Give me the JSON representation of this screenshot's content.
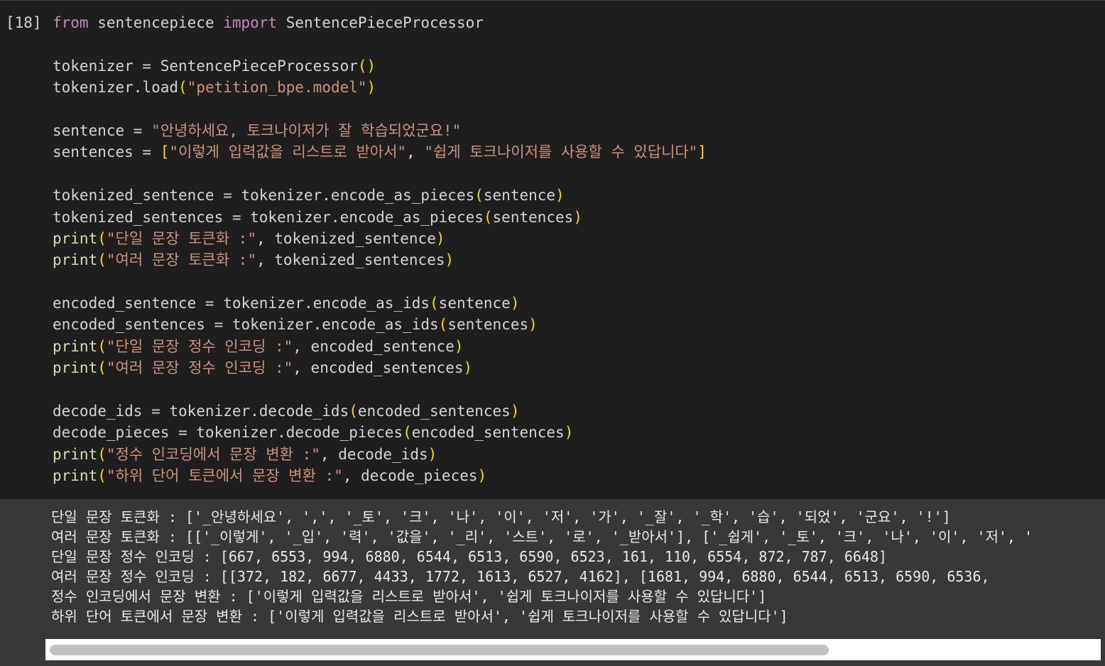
{
  "cell": {
    "prompt": "[18]",
    "code_lines": [
      [
        {
          "t": "from",
          "c": "kw"
        },
        {
          "t": " sentencepiece "
        },
        {
          "t": "import",
          "c": "kw"
        },
        {
          "t": " SentencePieceProcessor"
        }
      ],
      [],
      [
        {
          "t": "tokenizer = SentencePieceProcessor"
        },
        {
          "t": "()",
          "c": "br"
        }
      ],
      [
        {
          "t": "tokenizer.load"
        },
        {
          "t": "(",
          "c": "br"
        },
        {
          "t": "\"petition_bpe.model\"",
          "c": "str"
        },
        {
          "t": ")",
          "c": "br"
        }
      ],
      [],
      [
        {
          "t": "sentence = "
        },
        {
          "t": "\"안녕하세요, 토크나이저가 잘 학습되었군요!\"",
          "c": "str"
        }
      ],
      [
        {
          "t": "sentences = "
        },
        {
          "t": "[",
          "c": "br"
        },
        {
          "t": "\"이렇게 입력값을 리스트로 받아서\"",
          "c": "str"
        },
        {
          "t": ", "
        },
        {
          "t": "\"쉽게 토크나이저를 사용할 수 있답니다\"",
          "c": "str"
        },
        {
          "t": "]",
          "c": "br"
        }
      ],
      [],
      [
        {
          "t": "tokenized_sentence = tokenizer.encode_as_pieces"
        },
        {
          "t": "(",
          "c": "br"
        },
        {
          "t": "sentence"
        },
        {
          "t": ")",
          "c": "br"
        }
      ],
      [
        {
          "t": "tokenized_sentences = tokenizer.encode_as_pieces"
        },
        {
          "t": "(",
          "c": "br"
        },
        {
          "t": "sentences"
        },
        {
          "t": ")",
          "c": "br"
        }
      ],
      [
        {
          "t": "print",
          "c": "fn"
        },
        {
          "t": "(",
          "c": "br"
        },
        {
          "t": "\"단일 문장 토큰화 :\"",
          "c": "str"
        },
        {
          "t": ", tokenized_sentence"
        },
        {
          "t": ")",
          "c": "br"
        }
      ],
      [
        {
          "t": "print",
          "c": "fn"
        },
        {
          "t": "(",
          "c": "br"
        },
        {
          "t": "\"여러 문장 토큰화 :\"",
          "c": "str"
        },
        {
          "t": ", tokenized_sentences"
        },
        {
          "t": ")",
          "c": "br"
        }
      ],
      [],
      [
        {
          "t": "encoded_sentence = tokenizer.encode_as_ids"
        },
        {
          "t": "(",
          "c": "br"
        },
        {
          "t": "sentence"
        },
        {
          "t": ")",
          "c": "br"
        }
      ],
      [
        {
          "t": "encoded_sentences = tokenizer.encode_as_ids"
        },
        {
          "t": "(",
          "c": "br"
        },
        {
          "t": "sentences"
        },
        {
          "t": ")",
          "c": "br"
        }
      ],
      [
        {
          "t": "print",
          "c": "fn"
        },
        {
          "t": "(",
          "c": "br"
        },
        {
          "t": "\"단일 문장 정수 인코딩 :\"",
          "c": "str"
        },
        {
          "t": ", encoded_sentence"
        },
        {
          "t": ")",
          "c": "br"
        }
      ],
      [
        {
          "t": "print",
          "c": "fn"
        },
        {
          "t": "(",
          "c": "br"
        },
        {
          "t": "\"여러 문장 정수 인코딩 :\"",
          "c": "str"
        },
        {
          "t": ", encoded_sentences"
        },
        {
          "t": ")",
          "c": "br"
        }
      ],
      [],
      [
        {
          "t": "decode_ids = tokenizer.decode_ids"
        },
        {
          "t": "(",
          "c": "br"
        },
        {
          "t": "encoded_sentences"
        },
        {
          "t": ")",
          "c": "br"
        }
      ],
      [
        {
          "t": "decode_pieces = tokenizer.decode_pieces"
        },
        {
          "t": "(",
          "c": "br"
        },
        {
          "t": "encoded_sentences"
        },
        {
          "t": ")",
          "c": "br"
        }
      ],
      [
        {
          "t": "print",
          "c": "fn"
        },
        {
          "t": "(",
          "c": "br"
        },
        {
          "t": "\"정수 인코딩에서 문장 변환 :\"",
          "c": "str"
        },
        {
          "t": ", decode_ids"
        },
        {
          "t": ")",
          "c": "br"
        }
      ],
      [
        {
          "t": "print",
          "c": "fn"
        },
        {
          "t": "(",
          "c": "br"
        },
        {
          "t": "\"하위 단어 토큰에서 문장 변환 :\"",
          "c": "str"
        },
        {
          "t": ", decode_pieces"
        },
        {
          "t": ")",
          "c": "br"
        }
      ]
    ],
    "output_lines": [
      "단일 문장 토큰화 : ['_안녕하세요', ',', '_토', '크', '나', '이', '저', '가', '_잘', '_학', '습', '되었', '군요', '!']",
      "여러 문장 토큰화 : [['_이렇게', '_입', '력', '값을', '_리', '스트', '로', '_받아서'], ['_쉽게', '_토', '크', '나', '이', '저', '",
      "단일 문장 정수 인코딩 : [667, 6553, 994, 6880, 6544, 6513, 6590, 6523, 161, 110, 6554, 872, 787, 6648]",
      "여러 문장 정수 인코딩 : [[372, 182, 6677, 4433, 1772, 1613, 6527, 4162], [1681, 994, 6880, 6544, 6513, 6590, 6536, ",
      "정수 인코딩에서 문장 변환 : ['이렇게 입력값을 리스트로 받아서', '쉽게 토크나이저를 사용할 수 있답니다']",
      "하위 단어 토큰에서 문장 변환 : ['이렇게 입력값을 리스트로 받아서', '쉽게 토크나이저를 사용할 수 있답니다']"
    ]
  }
}
